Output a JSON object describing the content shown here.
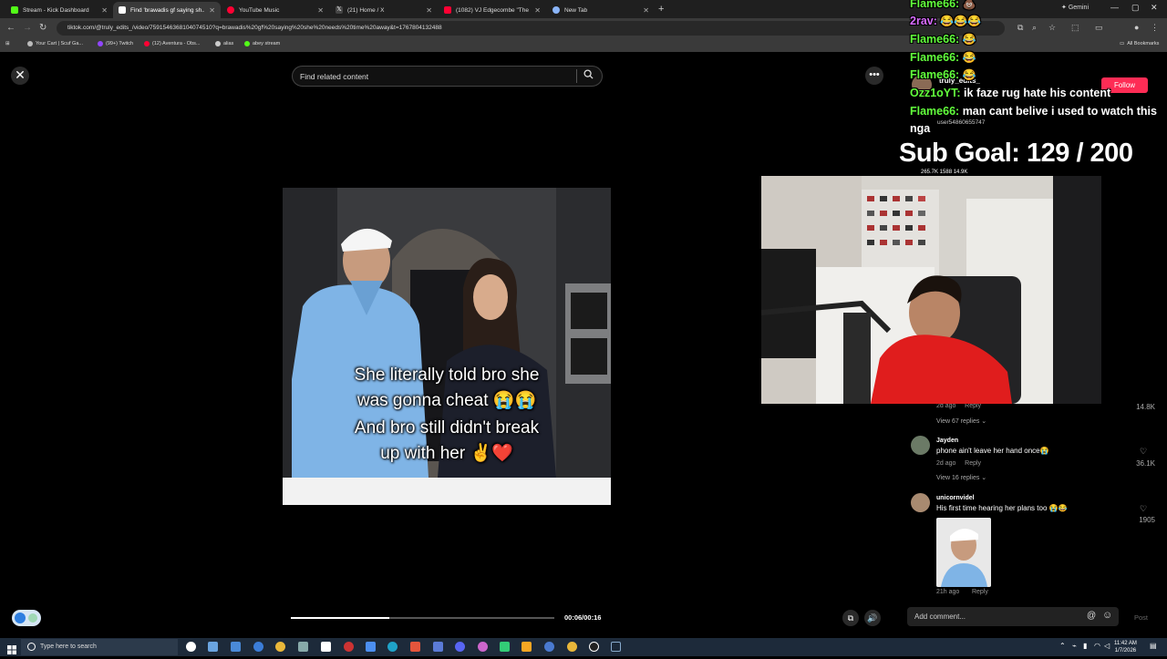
{
  "browser": {
    "tabs": [
      {
        "title": "Stream - Kick Dashboard",
        "color": "#53fc18",
        "active": false
      },
      {
        "title": "Find 'brawadis gf saying sh...",
        "color": "#ffffff",
        "active": true
      },
      {
        "title": "YouTube Music",
        "color": "#ff0033",
        "active": false
      },
      {
        "title": "(21) Home / X",
        "color": "#ffffff",
        "active": false
      },
      {
        "title": "(1082) VJ Edgecombe \"The Fut...",
        "color": "#ff0033",
        "active": false
      },
      {
        "title": "New Tab",
        "color": "#8ab4f8",
        "active": false
      }
    ],
    "new_tab": "+",
    "url": "tiktok.com/@truly_edits_/video/7591546368104074510?q=brawadis%20gf%20saying%20she%20needs%20time%20away&t=1767804132488",
    "gemini_label": "Gemini",
    "bookmarks": [
      {
        "label": "Your Cart | Scuf Ga...",
        "color": "#bbbbbb"
      },
      {
        "label": "(99+) Twitch",
        "color": "#9146ff"
      },
      {
        "label": "(12) Aventura - Obs...",
        "color": "#ff0033"
      },
      {
        "label": "alias",
        "color": "#cccccc"
      },
      {
        "label": "abey stream",
        "color": "#53fc18"
      }
    ],
    "all_bookmarks": "All Bookmarks"
  },
  "tiktok": {
    "search_placeholder": "Find related content",
    "caption_line1": "She literally told bro she",
    "caption_line2": "was gonna cheat 😭😭",
    "caption_line3": "And bro still didn't break",
    "caption_line4": "up with her ✌️❤️",
    "timecode": "00:06/00:16",
    "progress": 0.375,
    "creator": "truly_edits_",
    "follow_label": "Follow",
    "second_user": "user54860655747",
    "comment_placeholder": "Add comment...",
    "post_label": "Post"
  },
  "comments": {
    "c0_meta": "2d ago",
    "c0_reply": "Reply",
    "c0_views": "View 67 replies",
    "c0_likes": "14.8K",
    "c1_name": "Jayden",
    "c1_text": "phone ain't leave her hand once😭",
    "c1_meta": "2d ago",
    "c1_reply": "Reply",
    "c1_views": "View 16 replies",
    "c1_likes": "36.1K",
    "c2_name": "unicornvidel",
    "c2_text": "His first time hearing her plans too 😭😂",
    "c2_meta": "21h ago",
    "c2_reply": "Reply",
    "c2_likes": "1905"
  },
  "stream": {
    "chat": [
      {
        "user": "Flame66:",
        "msg": "💩"
      },
      {
        "user": "2rav:",
        "msg": "😂😂😂"
      },
      {
        "user": "Flame66:",
        "msg": "😂"
      },
      {
        "user": "Flame66:",
        "msg": "😂"
      },
      {
        "user": "Flame66:",
        "msg": "😂"
      },
      {
        "user": "Ozz1oYT:",
        "msg": "ik faze rug hate his content"
      },
      {
        "user": "Flame66:",
        "msg": "man cant belive i used to watch this"
      },
      {
        "user": "",
        "msg": "nga"
      }
    ],
    "sub_goal": "Sub Goal: 129 / 200",
    "stats": "265.7K   1588   14.9K"
  },
  "taskbar": {
    "search_placeholder": "Type here to search",
    "time": "11:42 AM",
    "date": "1/7/2026"
  }
}
